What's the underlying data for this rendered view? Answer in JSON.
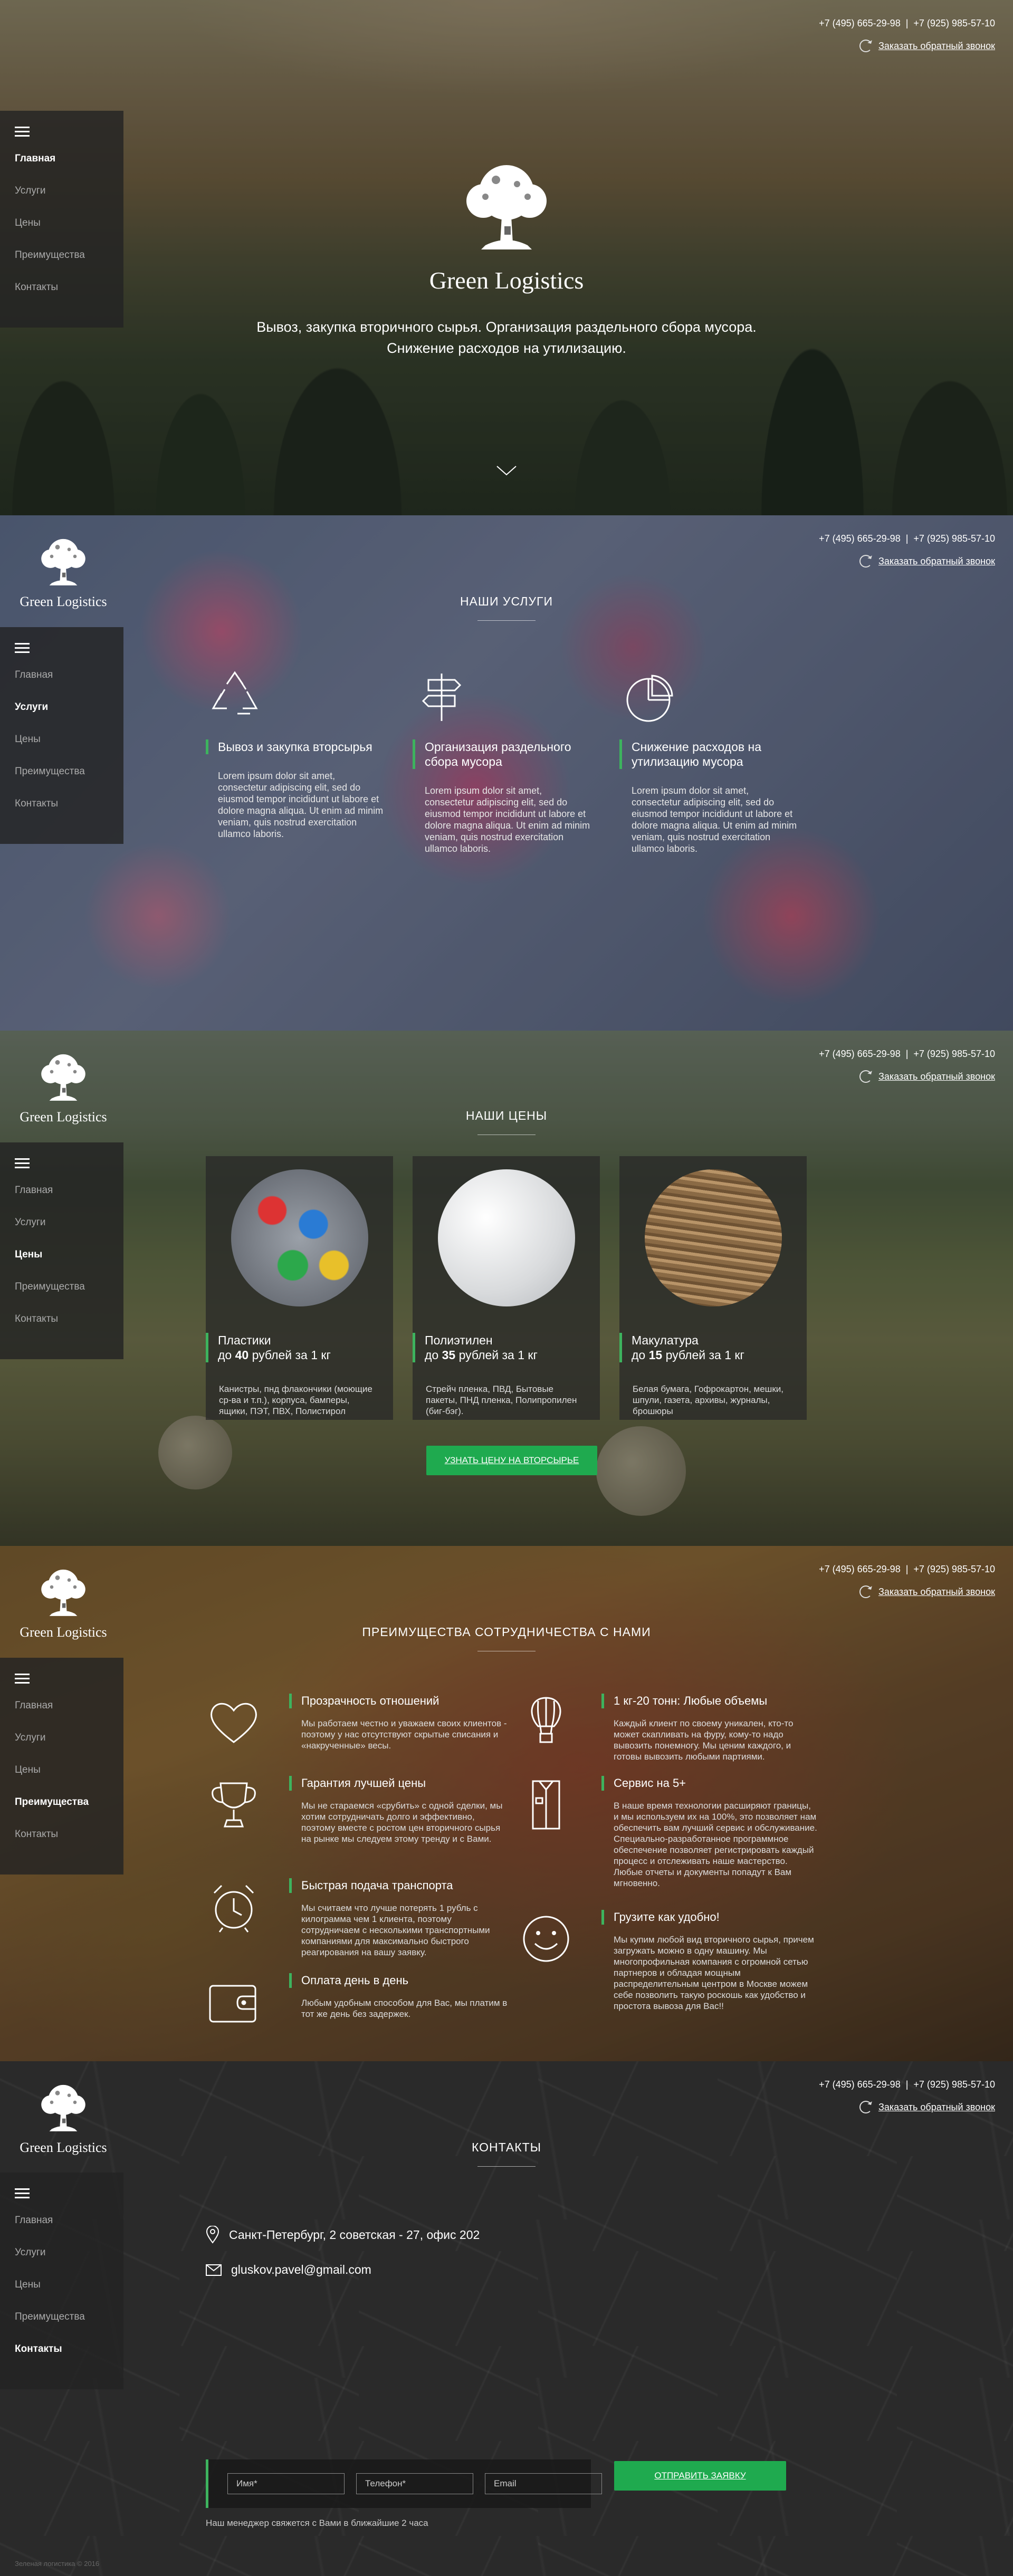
{
  "brand": {
    "name": "Green Logistics",
    "tagline_line1": "Вывоз, закупка вторичного сырья. Организация раздельного сбора мусора.",
    "tagline_line2": "Снижение расходов на утилизацию."
  },
  "header": {
    "phone1": "+7 (495) 665-29-98",
    "separator": "|",
    "phone2": "+7 (925) 985-57-10",
    "callback_label": "Заказать обратный звонок"
  },
  "nav": {
    "items": [
      "Главная",
      "Услуги",
      "Цены",
      "Преимущества",
      "Контакты"
    ]
  },
  "services": {
    "title": "НАШИ УСЛУГИ",
    "items": [
      {
        "title": "Вывоз и закупка вторсырья",
        "icon": "recycle-icon",
        "text": "Lorem ipsum dolor sit amet, consectetur adipiscing elit, sed do eiusmod tempor incididunt ut labore et dolore magna aliqua. Ut enim ad minim veniam, quis nostrud exercitation ullamco laboris."
      },
      {
        "title": "Организация раздельного сбора мусора",
        "icon": "signpost-icon",
        "text": "Lorem ipsum dolor sit amet, consectetur adipiscing elit, sed do eiusmod tempor incididunt ut labore et dolore magna aliqua. Ut enim ad minim veniam, quis nostrud exercitation ullamco laboris."
      },
      {
        "title": "Снижение расходов на утилизацию мусора",
        "icon": "pie-chart-icon",
        "text": "Lorem ipsum dolor sit amet, consectetur adipiscing elit, sed do eiusmod tempor incididunt ut labore et dolore magna aliqua. Ut enim ad minim veniam, quis nostrud exercitation ullamco laboris."
      }
    ]
  },
  "prices": {
    "title": "НАШИ ЦЕНЫ",
    "button": "УЗНАТЬ ЦЕНУ НА ВТОРСЫРЬЕ",
    "items": [
      {
        "name": "Пластики",
        "price_prefix": "до ",
        "price": "40",
        "price_suffix": " рублей за 1 кг",
        "text": "Канистры, пнд флакончики (моющие ср-ва и т.п.), корпуса, бамперы, ящики, ПЭТ, ПВХ, Полистирол"
      },
      {
        "name": "Полиэтилен",
        "price_prefix": "до ",
        "price": "35",
        "price_suffix": " рублей за 1 кг",
        "text": "Стрейч пленка, ПВД, Бытовые пакеты, ПНД пленка, Полипропилен (биг-бэг)."
      },
      {
        "name": "Макулатура",
        "price_prefix": "до ",
        "price": "15",
        "price_suffix": " рублей за 1 кг",
        "text": "Белая бумага, Гофрокартон, мешки, шпули, газета, архивы, журналы, брошюры"
      }
    ]
  },
  "advantages": {
    "title": "ПРЕИМУЩЕСТВА СОТРУДНИЧЕСТВА С НАМИ",
    "items": [
      {
        "title": "Прозрачность отношений",
        "icon": "heart-icon",
        "text": "Мы работаем честно и уважаем своих клиентов - поэтому у нас отсутствуют скрытые списания и «накрученные» весы."
      },
      {
        "title": "1 кг-20 тонн: Любые объемы",
        "icon": "hot-air-balloon-icon",
        "text": "Каждый клиент по своему уникален, кто-то может скапливать на фуру, кому-то надо вывозить понемногу. Мы ценим каждого, и готовы вывозить любыми партиями."
      },
      {
        "title": "Гарантия лучшей цены",
        "icon": "trophy-icon",
        "text": "Мы не стараемся «срубить» с одной сделки, мы хотим сотрудничать долго и эффективно, поэтому вместе с ростом цен вторичного сырья на рынке мы следуем этому тренду и с Вами."
      },
      {
        "title": "Сервис на 5+",
        "icon": "shirt-icon",
        "text": "В наше время технологии расширяют границы, и мы используем их на 100%, это позволяет нам обеспечить вам лучший сервис и обслуживание. Специально-разработанное программное обеспечение позволяет регистрировать каждый процесс и отслеживать наше мастерство. Любые отчеты и документы попадут к Вам мгновенно."
      },
      {
        "title": "Быстрая подача транспорта",
        "icon": "alarm-clock-icon",
        "text": "Мы считаем что лучше потерять 1 рубль с килограмма чем 1 клиента, поэтому сотрудничаем с несколькими транспортными компаниями для максимально быстрого реагирования на вашу заявку."
      },
      {
        "title": "Грузите как удобно!",
        "icon": "smiley-icon",
        "text": "Мы купим любой вид вторичного сырья, причем загружать можно в одну машину. Мы многопрофильная компания с огромной сетью партнеров и обладая мощным распределительным центром в Москве можем себе позволить такую роскошь как удобство и простота вывоза для Вас!!"
      },
      {
        "title": "Оплата день в день",
        "icon": "wallet-icon",
        "text": "Любым удобным способом для Вас, мы платим в тот же день без задержек."
      }
    ]
  },
  "contacts": {
    "title": "КОНТАКТЫ",
    "address": "Санкт-Петербург, 2 советская - 27, офис 202",
    "email": "gluskov.pavel@gmail.com",
    "form": {
      "name_placeholder": "Имя*",
      "phone_placeholder": "Телефон*",
      "email_placeholder": "Email",
      "submit": "ОТПРАВИТЬ ЗАЯВКУ"
    },
    "note": "Наш менеджер свяжется с Вами в ближайшие 2 часа",
    "copyright": "Зеленая логистика © 2016"
  }
}
